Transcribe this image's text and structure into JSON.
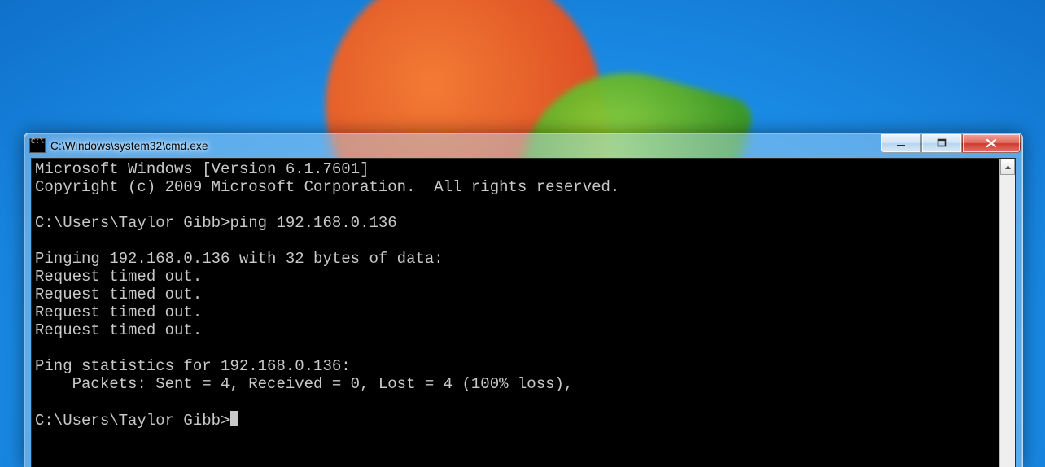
{
  "window": {
    "title": "C:\\Windows\\system32\\cmd.exe"
  },
  "console": {
    "line1": "Microsoft Windows [Version 6.1.7601]",
    "line2": "Copyright (c) 2009 Microsoft Corporation.  All rights reserved.",
    "blank1": "",
    "prompt1": "C:\\Users\\Taylor Gibb>ping 192.168.0.136",
    "blank2": "",
    "pinging": "Pinging 192.168.0.136 with 32 bytes of data:",
    "r1": "Request timed out.",
    "r2": "Request timed out.",
    "r3": "Request timed out.",
    "r4": "Request timed out.",
    "blank3": "",
    "stats1": "Ping statistics for 192.168.0.136:",
    "stats2": "    Packets: Sent = 4, Received = 0, Lost = 4 (100% loss),",
    "blank4": "",
    "prompt2": "C:\\Users\\Taylor Gibb>"
  }
}
